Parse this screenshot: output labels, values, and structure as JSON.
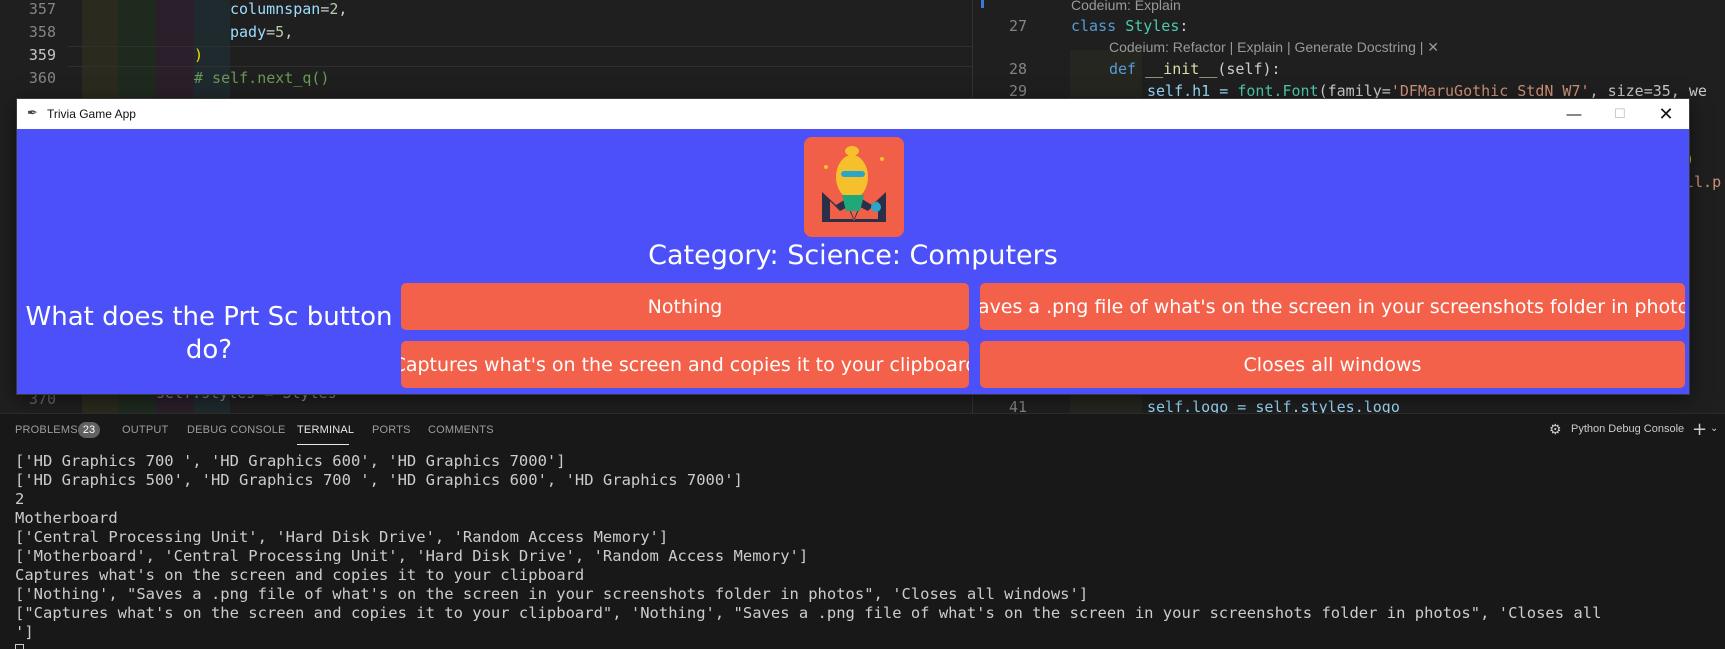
{
  "editor_left": {
    "lines": [
      {
        "num": "357",
        "code": "columnspan",
        "op": "=",
        "val": "2",
        "tail": ","
      },
      {
        "num": "358",
        "code": "pady",
        "op": "=",
        "val": "5",
        "tail": ","
      },
      {
        "num": "359",
        "paren": ")"
      },
      {
        "num": "360",
        "comment": "# self.next_q()"
      }
    ],
    "hidden_line_num": "370",
    "partial_line": "self.styles = Styles"
  },
  "editor_right": {
    "lens_top": "Codeium: Explain",
    "line27": {
      "num": "27",
      "kw": "class",
      "name": "Styles",
      "colon": ":"
    },
    "lens_mid": "Codeium: Refactor | Explain | Generate Docstring | ✕",
    "line28": {
      "num": "28",
      "kw": "def",
      "name": "__init__",
      "args": "(self):"
    },
    "line29": {
      "num": "29",
      "pre": "self.h1 = ",
      "call": "font.Font",
      "arg1": "(family=",
      "str": "'DFMaruGothic StdN W7'",
      "rest": ", size=35, we"
    },
    "line41": {
      "num": "41",
      "code": "self.logo = self.styles.logo"
    },
    "peek_paren": ")",
    "peek_tail": "ll.p"
  },
  "app_window": {
    "title": "Trivia Game App",
    "category": "Category: Science: Computers",
    "question": "What does the Prt Sc button do?",
    "answers": [
      "Nothing",
      "Saves a .png file of what's on the screen in your screenshots folder in photos",
      "Captures what's on the screen and copies it to your clipboard",
      "Closes all windows"
    ],
    "colors": {
      "background": "#4b50f8",
      "button": "#f4614a",
      "logo_bg": "#f15f48"
    }
  },
  "panel": {
    "tabs": [
      "PROBLEMS",
      "OUTPUT",
      "DEBUG CONSOLE",
      "TERMINAL",
      "PORTS",
      "COMMENTS"
    ],
    "problems_count": "23",
    "active_tab": "TERMINAL",
    "terminal_name": "Python Debug Console"
  },
  "terminal": {
    "lines": [
      "['HD Graphics 700 ', 'HD Graphics 600', 'HD Graphics 7000']",
      "['HD Graphics 500', 'HD Graphics 700 ', 'HD Graphics 600', 'HD Graphics 7000']",
      "2",
      "Motherboard",
      "['Central Processing Unit', 'Hard Disk Drive', 'Random Access Memory']",
      "['Motherboard', 'Central Processing Unit', 'Hard Disk Drive', 'Random Access Memory']",
      "Captures what's on the screen and copies it to your clipboard",
      "['Nothing', \"Saves a .png file of what's on the screen in your screenshots folder in photos\", 'Closes all windows']",
      "[\"Captures what's on the screen and copies it to your clipboard\", 'Nothing', \"Saves a .png file of what's on the screen in your screenshots folder in photos\", 'Closes all",
      "']"
    ]
  }
}
